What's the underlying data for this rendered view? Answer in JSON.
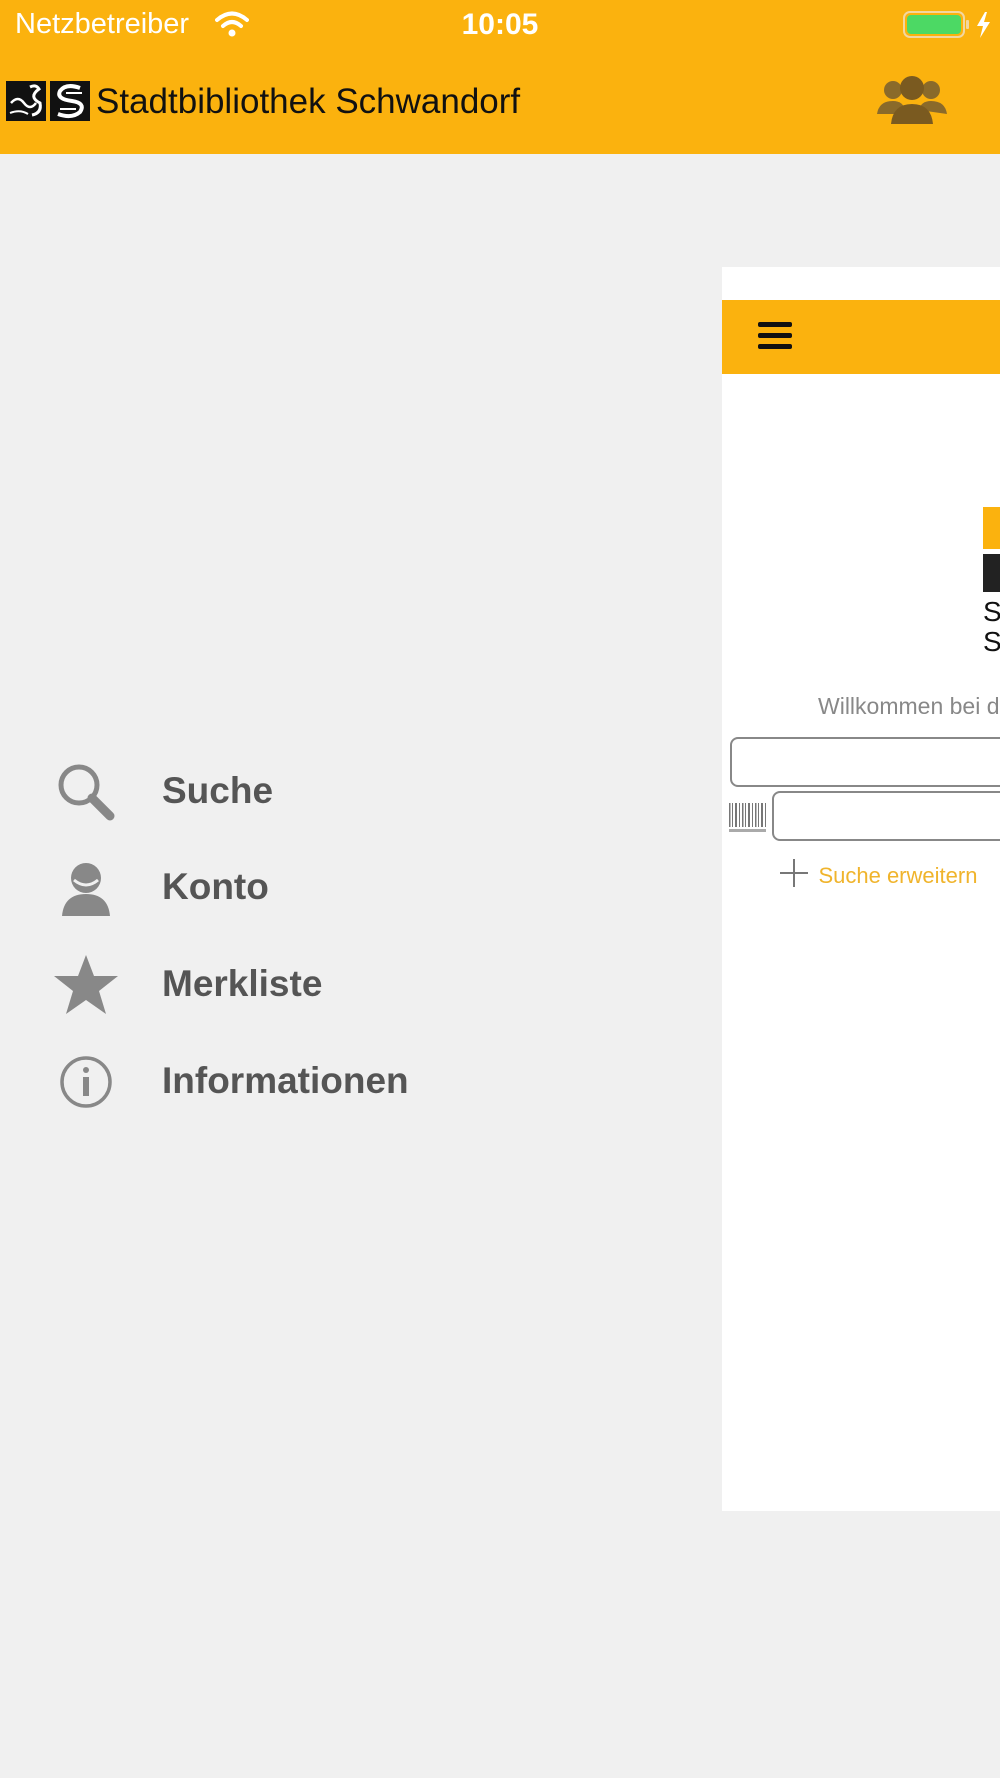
{
  "status_bar": {
    "carrier": "Netzbetreiber",
    "time": "10:05",
    "wifi_icon": "wifi-icon",
    "battery_icon": "battery-charging-icon"
  },
  "header": {
    "title": "Stadtbibliothek Schwandorf",
    "logo_icon": "library-logo-icon",
    "profile_icon": "users-icon",
    "background_color": "#fbb20e"
  },
  "side_menu": {
    "items": [
      {
        "label": "Suche",
        "icon": "search-icon"
      },
      {
        "label": "Konto",
        "icon": "account-icon"
      },
      {
        "label": "Merkliste",
        "icon": "star-icon"
      },
      {
        "label": "Informationen",
        "icon": "info-icon"
      }
    ]
  },
  "content": {
    "menu_icon": "hamburger-icon",
    "logo_text_line1": "St",
    "logo_text_line2": "Sc",
    "welcome_text": "Willkommen bei d",
    "search_field_value": "",
    "scan_field_value": "",
    "barcode_icon": "barcode-icon",
    "extend_search_label": "Suche erweitern",
    "accent_color": "#f0b42c"
  }
}
